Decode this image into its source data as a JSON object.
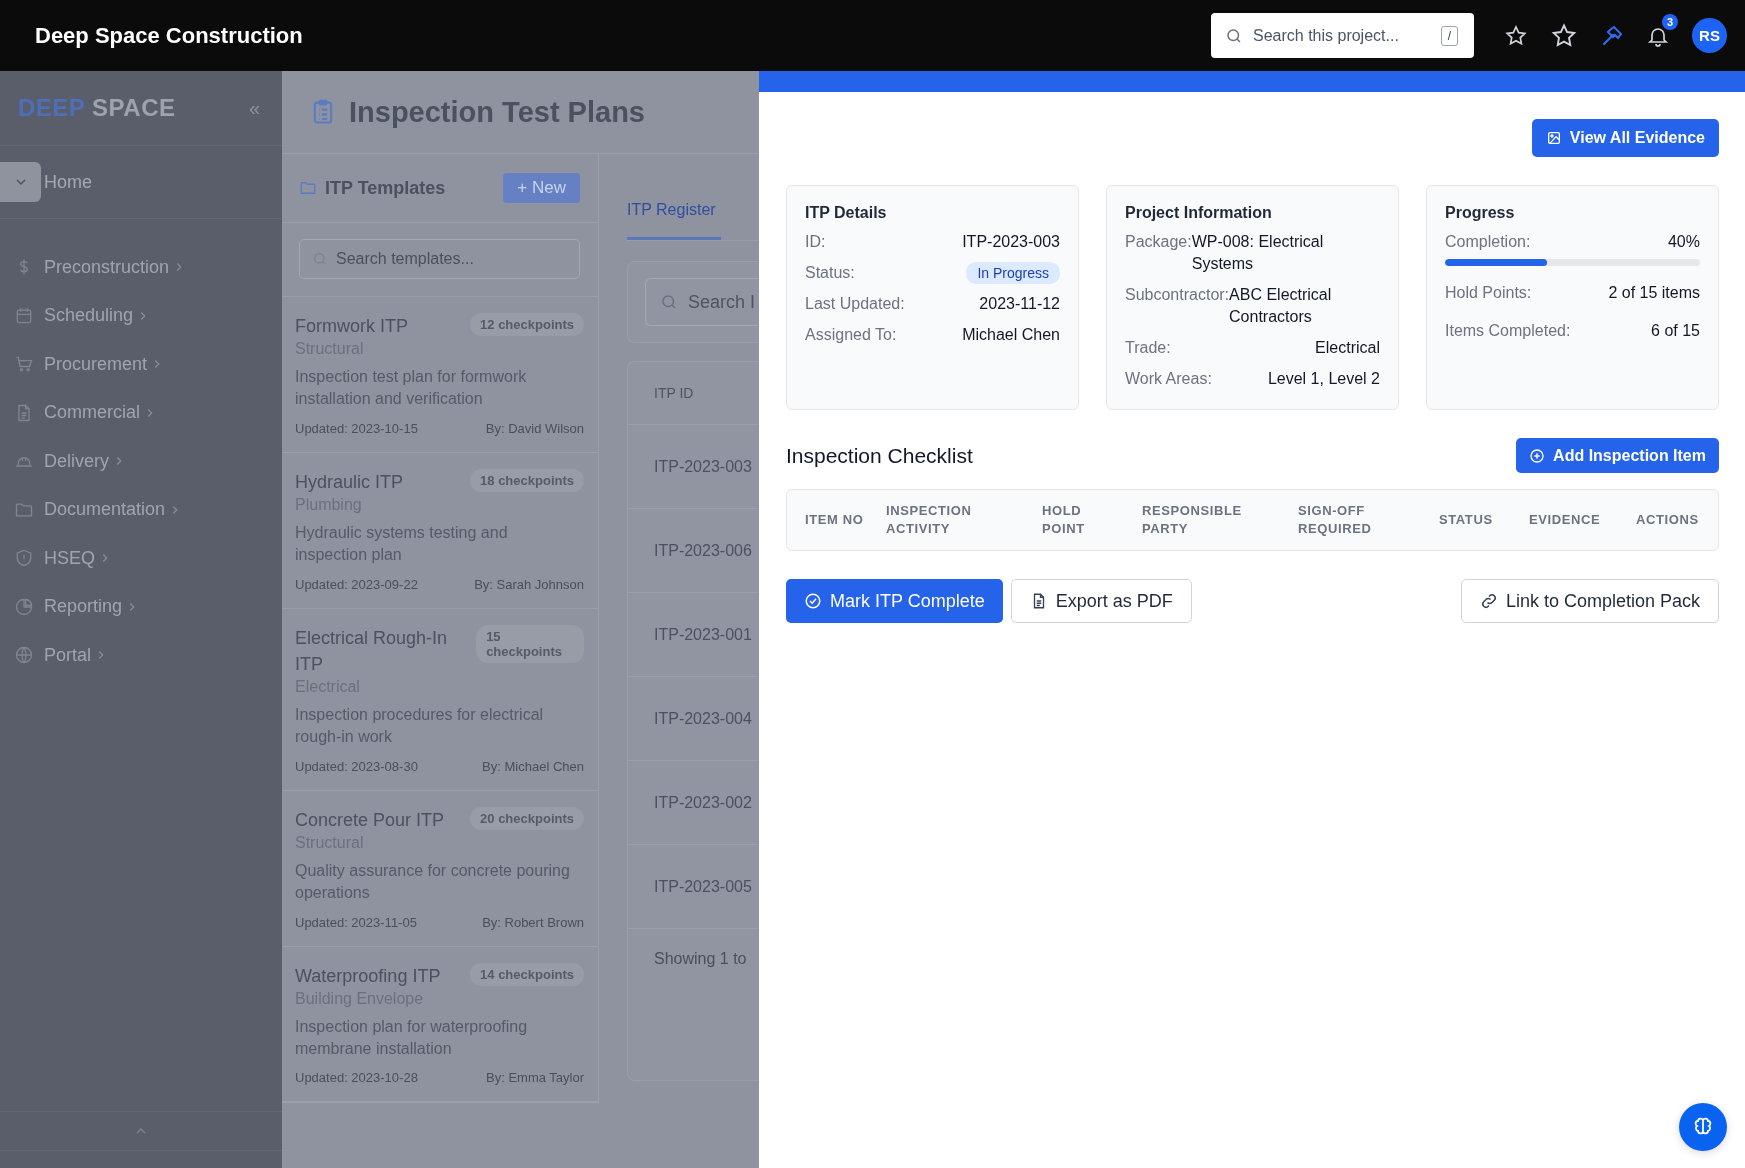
{
  "topbar": {
    "title": "Deep Space Construction",
    "search": {
      "placeholder": "Search this project...",
      "shortcut": "/"
    },
    "notifications": "3",
    "avatar": "RS"
  },
  "sidebar": {
    "logo": {
      "accent": "DEEP",
      "rest": "SPACE"
    },
    "collapse": "«",
    "home": {
      "label": "Home",
      "expanded": true
    },
    "items": [
      {
        "label": "Preconstruction"
      },
      {
        "label": "Scheduling"
      },
      {
        "label": "Procurement"
      },
      {
        "label": "Commercial"
      },
      {
        "label": "Delivery"
      },
      {
        "label": "Documentation"
      },
      {
        "label": "HSEQ"
      },
      {
        "label": "Reporting"
      },
      {
        "label": "Portal"
      }
    ]
  },
  "page": {
    "title": "Inspection Test Plans"
  },
  "templates": {
    "title": "ITP Templates",
    "new_button": "+ New",
    "search": {
      "placeholder": "Search templates..."
    },
    "items": [
      {
        "title": "Formwork ITP",
        "badge": "12 checkpoints",
        "category": "Structural",
        "description": "Inspection test plan for formwork installation and verification",
        "updated": "Updated: 2023-10-15",
        "by": "By: David Wilson"
      },
      {
        "title": "Hydraulic ITP",
        "badge": "18 checkpoints",
        "category": "Plumbing",
        "description": "Hydraulic systems testing and inspection plan",
        "updated": "Updated: 2023-09-22",
        "by": "By: Sarah Johnson"
      },
      {
        "title": "Electrical Rough-In ITP",
        "badge": "15 checkpoints",
        "category": "Electrical",
        "description": "Inspection procedures for electrical rough-in work",
        "updated": "Updated: 2023-08-30",
        "by": "By: Michael Chen"
      },
      {
        "title": "Concrete Pour ITP",
        "badge": "20 checkpoints",
        "category": "Structural",
        "description": "Quality assurance for concrete pouring operations",
        "updated": "Updated: 2023-11-05",
        "by": "By: Robert Brown"
      },
      {
        "title": "Waterproofing ITP",
        "badge": "14 checkpoints",
        "category": "Building Envelope",
        "description": "Inspection plan for waterproofing membrane installation",
        "updated": "Updated: 2023-10-28",
        "by": "By: Emma Taylor"
      }
    ]
  },
  "register": {
    "tabs": [
      {
        "label": "ITP Register",
        "selected": true
      }
    ],
    "search": {
      "placeholder": "Search I"
    },
    "columns": [
      "ITP ID"
    ],
    "rows": [
      "ITP-2023-003",
      "ITP-2023-006",
      "ITP-2023-001",
      "ITP-2023-004",
      "ITP-2023-002",
      "ITP-2023-005"
    ],
    "footer": "Showing 1 to"
  },
  "detail": {
    "view_evidence_button": "View All Evidence",
    "cards": [
      {
        "kind": "rows",
        "title": "ITP Details",
        "rows": [
          {
            "kind": "text",
            "label": "ID:",
            "value": "ITP-2023-003"
          },
          {
            "kind": "badge",
            "label": "Status:",
            "value": "In Progress"
          },
          {
            "kind": "text",
            "label": "Last Updated:",
            "value": "2023-11-12"
          },
          {
            "kind": "text",
            "label": "Assigned To:",
            "value": "Michael Chen"
          }
        ]
      },
      {
        "kind": "rows",
        "title": "Project Information",
        "rows": [
          {
            "kind": "text",
            "label": "Package:",
            "value": "WP-008: Electrical Systems"
          },
          {
            "kind": "text",
            "label": "Subcontractor:",
            "value": "ABC Electrical Contractors"
          },
          {
            "kind": "text",
            "label": "Trade:",
            "value": "Electrical"
          },
          {
            "kind": "text",
            "label": "Work Areas:",
            "value": "Level 1, Level 2"
          }
        ]
      },
      {
        "kind": "progress",
        "title": "Progress",
        "rows": [
          {
            "kind": "meter",
            "label": "Completion:",
            "value": "40%",
            "level": 0.4
          },
          {
            "kind": "text",
            "label": "Hold Points:",
            "value": "2 of 15 items"
          },
          {
            "kind": "text",
            "label": "Items Completed:",
            "value": "6 of 15"
          }
        ]
      }
    ],
    "checklist": {
      "title": "Inspection Checklist",
      "add_button": "Add Inspection Item",
      "columns": [
        "ITEM NO",
        "INSPECTION ACTIVITY",
        "HOLD POINT",
        "RESPONSIBLE PARTY",
        "SIGN-OFF REQUIRED",
        "STATUS",
        "EVIDENCE",
        "ACTIONS"
      ]
    },
    "actions": [
      {
        "kind": "primary",
        "label": "Mark ITP Complete"
      },
      {
        "kind": "pdf",
        "label": "Export as PDF"
      },
      {
        "kind": "link",
        "label": "Link to Completion Pack"
      }
    ]
  }
}
